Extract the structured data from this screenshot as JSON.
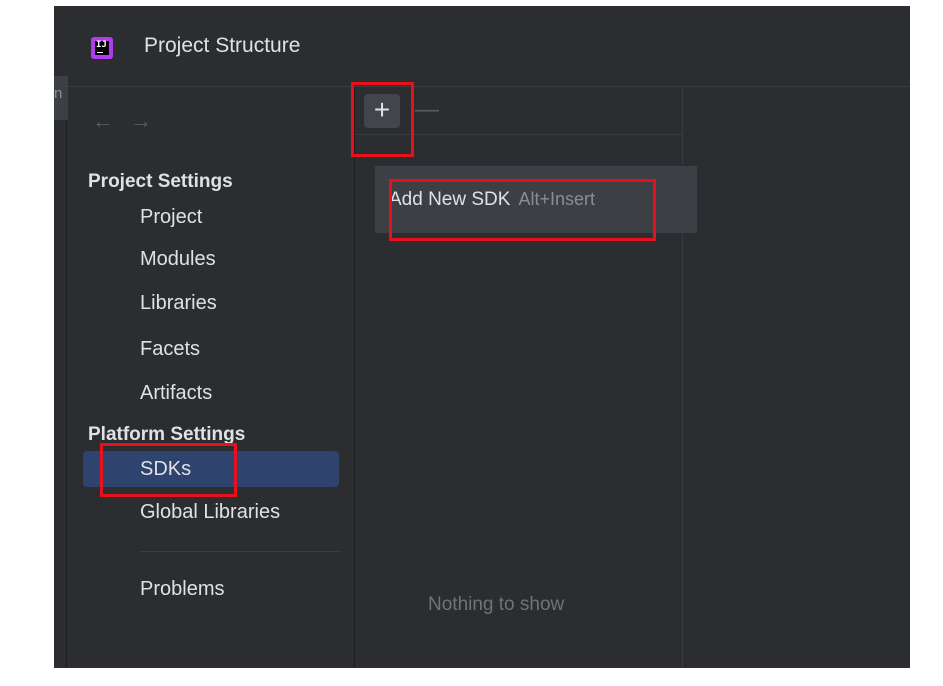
{
  "window": {
    "title": "Project Structure",
    "app_icon": "intellij-idea-icon",
    "left_edge_glyph": "n"
  },
  "nav": {
    "back_icon": "←",
    "forward_icon": "→"
  },
  "sidebar": {
    "project_settings_heading": "Project Settings",
    "project_items": [
      {
        "label": "Project"
      },
      {
        "label": "Modules"
      },
      {
        "label": "Libraries"
      },
      {
        "label": "Facets"
      },
      {
        "label": "Artifacts"
      }
    ],
    "platform_settings_heading": "Platform Settings",
    "platform_items": [
      {
        "label": "SDKs",
        "selected": true
      },
      {
        "label": "Global Libraries"
      }
    ],
    "problems_label": "Problems"
  },
  "toolbar": {
    "add_glyph": "+",
    "remove_glyph": "—"
  },
  "popup": {
    "item_label": "Add New SDK",
    "item_shortcut": "Alt+Insert"
  },
  "list": {
    "empty_text": "Nothing to show"
  },
  "colors": {
    "background": "#2b2d30",
    "selection": "#2e436e",
    "highlight": "#e8111a"
  }
}
